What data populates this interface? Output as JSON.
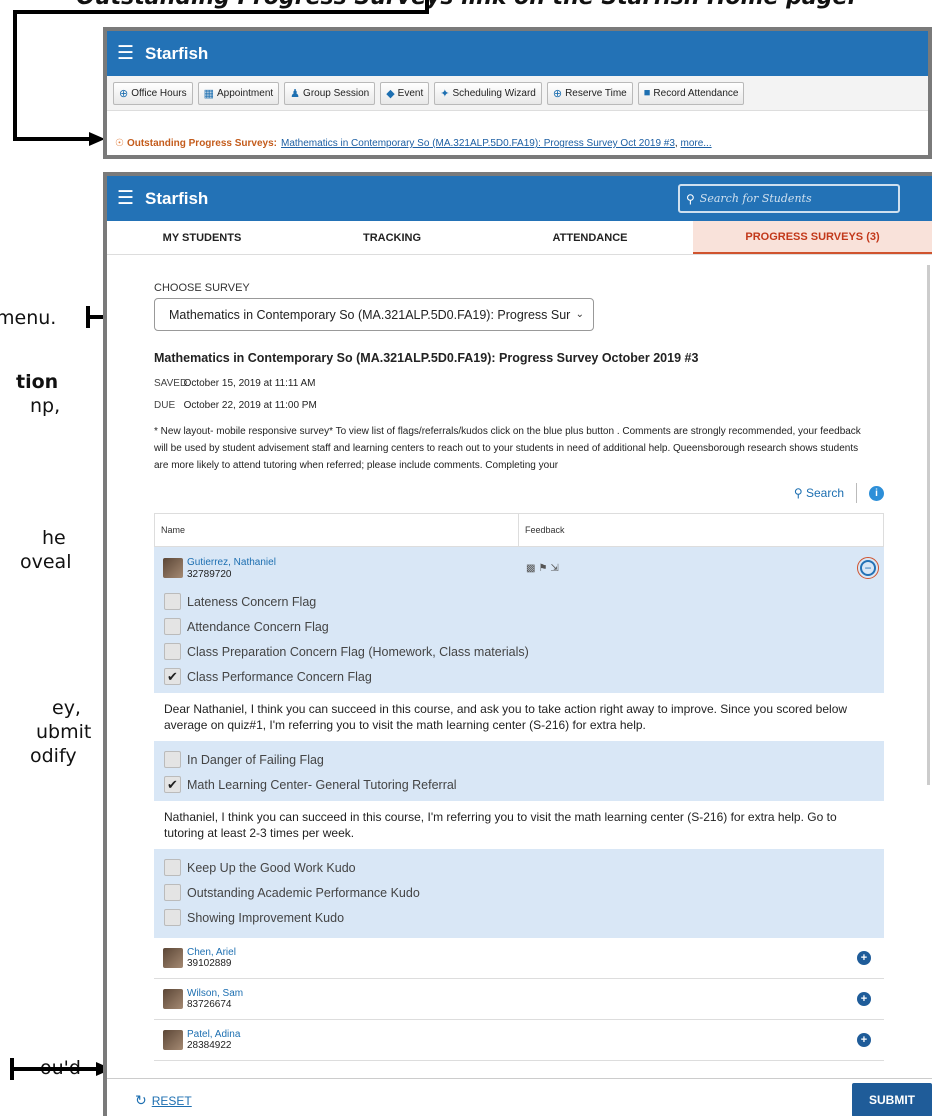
{
  "annotations": {
    "top": "Outstanding Progress Surveys link on the Starfish Home page.",
    "menu": "menu.",
    "tion": "tion",
    "np": "np,",
    "he": "he",
    "oveal": "oveal",
    "ey": "ey,",
    "ubmit": "ubmit",
    "odify": "odify",
    "oud": "ou'd"
  },
  "home": {
    "brand": "Starfish",
    "toolbar": [
      "Office Hours",
      "Appointment",
      "Group Session",
      "Event",
      "Scheduling Wizard",
      "Reserve Time",
      "Record Attendance"
    ],
    "banner_label": "Outstanding Progress Surveys:",
    "banner_link": "Mathematics in Contemporary So (MA.321ALP.5D0.FA19): Progress Survey Oct 2019 #3",
    "banner_more": "more..."
  },
  "app": {
    "brand": "Starfish",
    "search_placeholder": "Search for Students",
    "tabs": [
      "MY STUDENTS",
      "TRACKING",
      "ATTENDANCE",
      "PROGRESS SURVEYS (3)"
    ],
    "choose_label": "CHOOSE SURVEY",
    "selected_survey": "Mathematics in Contemporary So (MA.321ALP.5D0.FA19): Progress Sur",
    "survey_title": "Mathematics in Contemporary So (MA.321ALP.5D0.FA19): Progress Survey October 2019 #3",
    "saved_label": "SAVED",
    "saved_value": "October 15, 2019 at 11:11 AM",
    "due_label": "DUE",
    "due_value": "October 22, 2019 at 11:00 PM",
    "description": "* New layout- mobile responsive survey* To view list of flags/referrals/kudos click on the blue plus button . Comments are strongly recommended, your feedback will be used by student advisement staff and learning centers to reach out to your students in need of additional help. Queensborough research shows students are more likely to attend tutoring when referred; please include comments. Completing your",
    "search_link": "Search",
    "info_glyph": "i",
    "col_name": "Name",
    "col_feedback": "Feedback",
    "expanded_student": {
      "name": "Gutierrez, Nathaniel",
      "id": "32789720"
    },
    "items": [
      {
        "label": "Lateness Concern Flag",
        "checked": false
      },
      {
        "label": "Attendance Concern Flag",
        "checked": false
      },
      {
        "label": "Class Preparation Concern Flag (Homework, Class materials)",
        "checked": false
      },
      {
        "label": "Class Performance Concern Flag",
        "checked": true
      },
      {
        "label": "In Danger of Failing Flag",
        "checked": false
      },
      {
        "label": "Math Learning Center- General Tutoring Referral",
        "checked": true
      },
      {
        "label": "Keep Up the Good Work Kudo",
        "checked": false
      },
      {
        "label": "Outstanding Academic Performance Kudo",
        "checked": false
      },
      {
        "label": "Showing Improvement Kudo",
        "checked": false
      }
    ],
    "comment1": "Dear Nathaniel,  I think you can succeed in this course, and ask you to take action right away to improve. Since you scored below average on quiz#1, I'm referring you to visit the math learning center (S-216) for extra help.",
    "comment2": "Nathaniel,  I think you can succeed in this course, I'm referring you to visit the math learning center (S-216) for extra help. Go to tutoring at least 2-3 times per week.",
    "students": [
      {
        "name": "Chen, Ariel",
        "id": "39102889"
      },
      {
        "name": "Wilson, Sam",
        "id": "83726674"
      },
      {
        "name": "Patel, Adina",
        "id": "28384922"
      }
    ],
    "reset": "RESET",
    "submit": "SUBMIT"
  }
}
